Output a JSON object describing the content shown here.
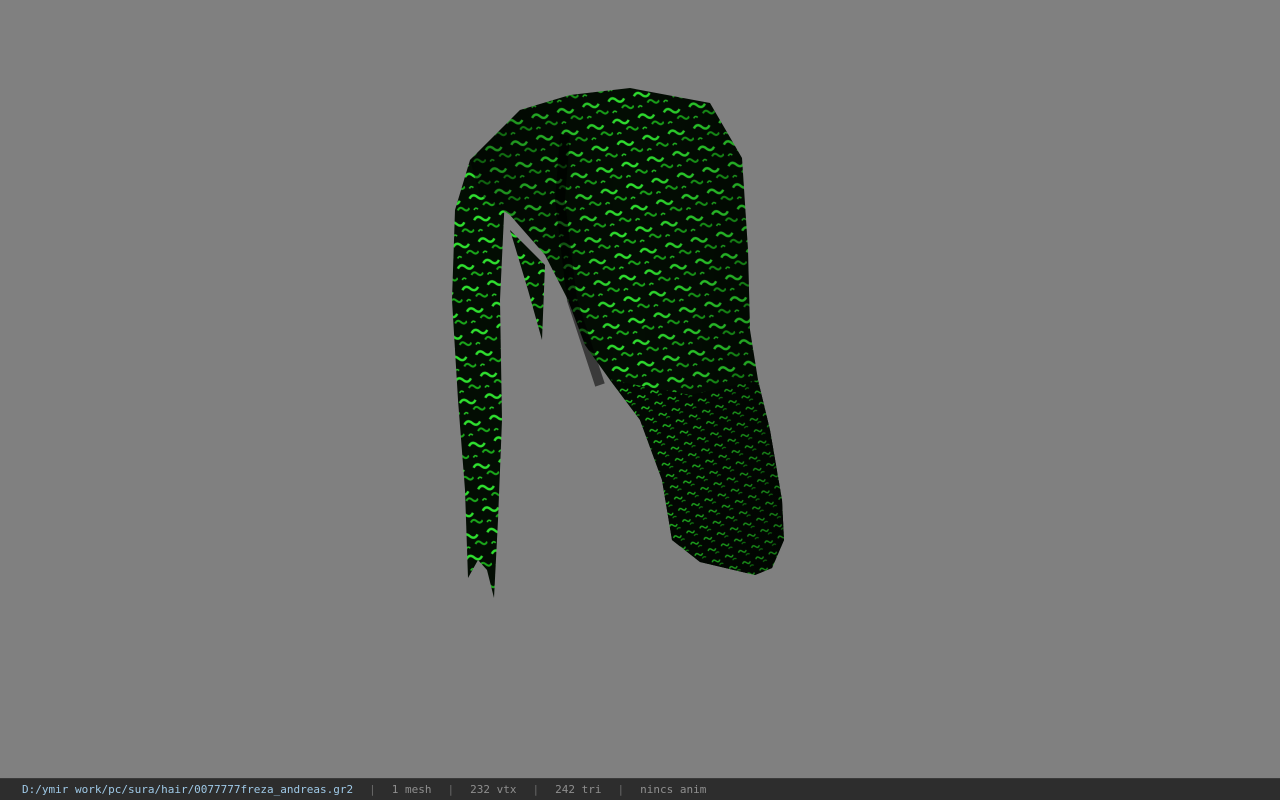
{
  "viewer": {
    "background_color": "#808080",
    "model_colors": {
      "base": "#020a02",
      "pattern_bright": "#2fe02f",
      "pattern_mid": "#17a317"
    }
  },
  "status": {
    "file_path": "D:/ymir work/pc/sura/hair/0077777freza_andreas.gr2",
    "separator": "|",
    "mesh_count": "1 mesh",
    "vertex_count": "232 vtx",
    "triangle_count": "242 tri",
    "anim_status": "nincs anim"
  }
}
